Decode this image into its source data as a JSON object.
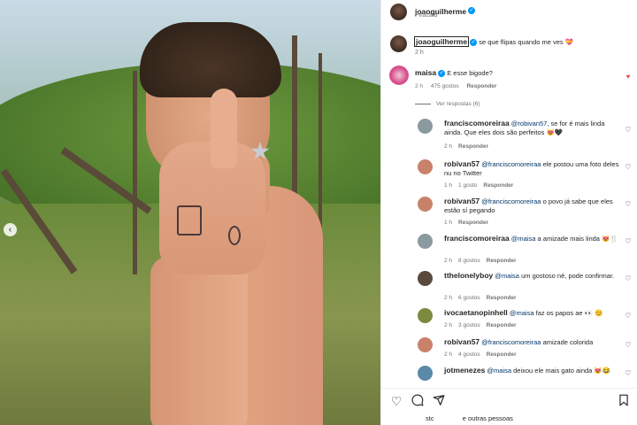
{
  "post": {
    "username": "joaoguilherme",
    "location": "Piracaia",
    "caption_user": "joaoguilherme",
    "caption_text": "se que flipas quando me ves 💝",
    "caption_time": "2 h"
  },
  "top_comment": {
    "username": "maisa",
    "text": "E esse bigode?",
    "time": "2 h",
    "likes": "475 gostos",
    "reply": "Responder",
    "view_replies": "Ver respostas (6)"
  },
  "replies": [
    {
      "username": "franciscomoreiraa",
      "mention": "@robivan57",
      "text": ", se for é mais linda ainda. Que eles dois são perfeitos 😻🖤",
      "time": "2 h",
      "likes": "",
      "reply": "Responder"
    },
    {
      "username": "robivan57",
      "mention": "@franciscomoreiraa",
      "text": "ele postou uma foto deles nu no Twitter",
      "time": "1 h",
      "likes": "1 gosto",
      "reply": "Responder"
    },
    {
      "username": "robivan57",
      "mention": "@franciscomoreiraa",
      "text": "o povo já sabe que eles estão sí pegando",
      "time": "1 h",
      "likes": "",
      "reply": "Responder"
    },
    {
      "username": "franciscomoreiraa",
      "mention": "@maisa",
      "text": "a amizade mais linda 😻🍴",
      "time": "2 h",
      "likes": "8 gostos",
      "reply": "Responder"
    },
    {
      "username": "tthelonelyboy",
      "mention": "@maisa",
      "text": "um gostoso né, pode confirmar.",
      "time": "2 h",
      "likes": "6 gostos",
      "reply": "Responder"
    },
    {
      "username": "ivocaetanopinhell",
      "mention": "@maisa",
      "text": "faz os papos ae 👀 😊",
      "time": "2 h",
      "likes": "3 gostos",
      "reply": "Responder"
    },
    {
      "username": "robivan57",
      "mention": "@franciscomoreiraa",
      "text": "amizade colorida",
      "time": "2 h",
      "likes": "4 gostos",
      "reply": "Responder"
    },
    {
      "username": "jotmenezes",
      "mention": "@maisa",
      "text": "deixou ele mais gato ainda 😻😂",
      "time": "",
      "likes": "",
      "reply": ""
    }
  ],
  "footer": {
    "liked_by": "stc",
    "others": "e outras pessoas"
  },
  "icons": {
    "heart": "heart-icon",
    "comment": "comment-icon",
    "share": "share-icon",
    "save": "bookmark-icon"
  },
  "colors": {
    "verified": "#0095f6",
    "like_red": "#ed4956",
    "mention": "#00376b"
  }
}
